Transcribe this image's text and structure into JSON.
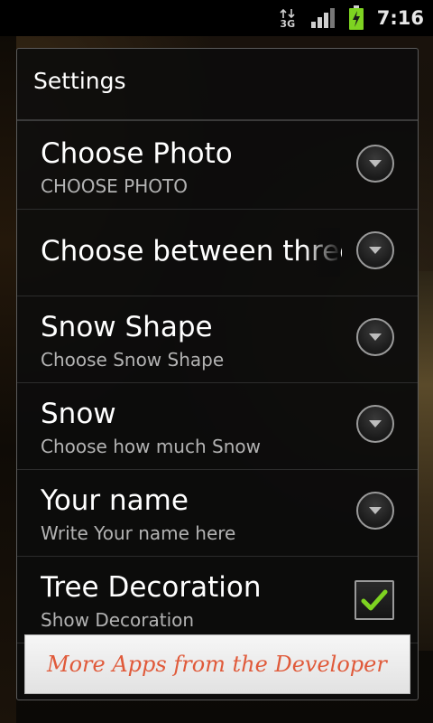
{
  "status_bar": {
    "network_label": "3G",
    "time": "7:16",
    "icons": [
      "data-3g-icon",
      "signal-strength-icon",
      "battery-charging-icon"
    ]
  },
  "dialog": {
    "title": "Settings",
    "items": [
      {
        "title": "Choose Photo",
        "summary": "CHOOSE PHOTO",
        "control": "dropdown"
      },
      {
        "title": "Choose between three",
        "summary": "",
        "control": "dropdown"
      },
      {
        "title": "Snow Shape",
        "summary": "Choose Snow Shape",
        "control": "dropdown"
      },
      {
        "title": "Snow",
        "summary": "Choose how much Snow",
        "control": "dropdown"
      },
      {
        "title": "Your name",
        "summary": "Write Your name here",
        "control": "dropdown"
      },
      {
        "title": "Tree Decoration",
        "summary": "Show Decoration",
        "control": "checkbox",
        "checked": true
      }
    ]
  },
  "footer": {
    "more_apps_label": "More Apps from the Developer",
    "label_color": "#e05a3a"
  },
  "colors": {
    "check_green": "#7ed321"
  }
}
